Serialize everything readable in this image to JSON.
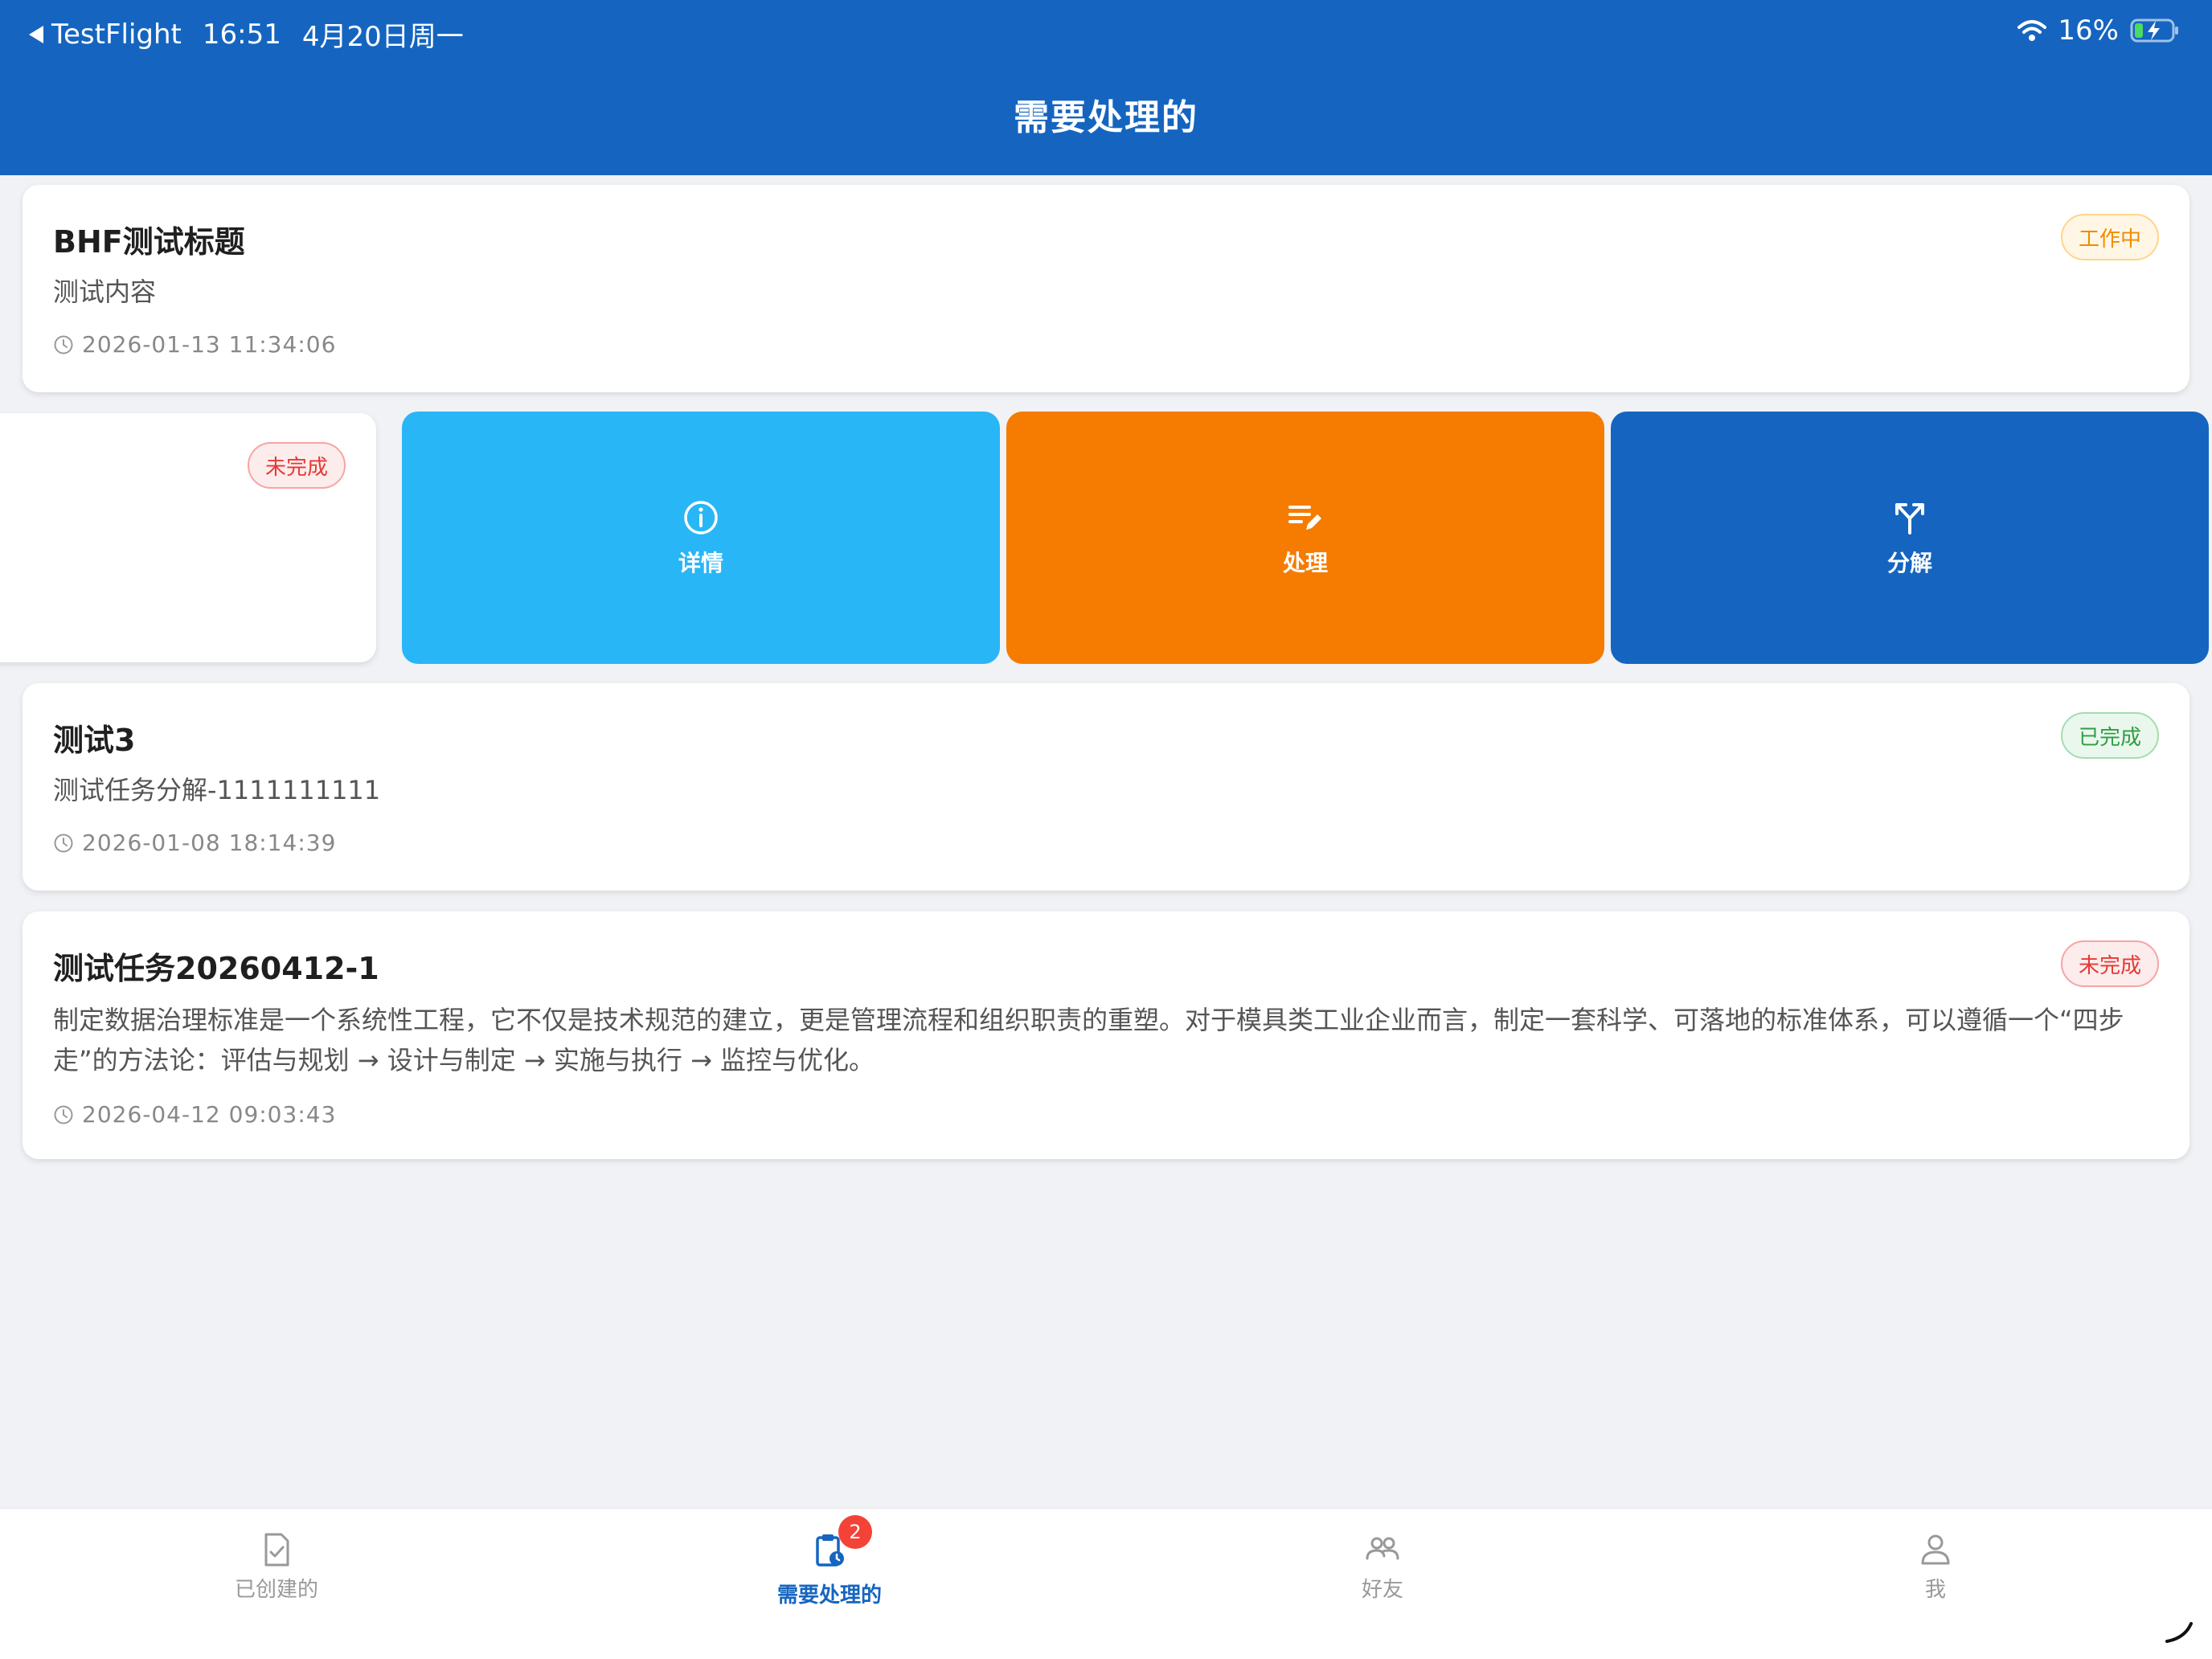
{
  "status_bar": {
    "back_app": "TestFlight",
    "time": "16:51",
    "date": "4月20日周一",
    "battery": "16%"
  },
  "header": {
    "title": "需要处理的"
  },
  "tasks": [
    {
      "title": "BHF测试标题",
      "content": "测试内容",
      "time": "2026-01-13 11:34:06",
      "status": "工作中"
    },
    {
      "status": "未完成",
      "swipe_actions": [
        {
          "label": "详情",
          "icon": "info-icon",
          "color": "#29b6f6"
        },
        {
          "label": "处理",
          "icon": "edit-list-icon",
          "color": "#f57c00"
        },
        {
          "label": "分解",
          "icon": "split-icon",
          "color": "#1565c0"
        }
      ]
    },
    {
      "title": "测试3",
      "content": "测试任务分解-1111111111",
      "time": "2026-01-08 18:14:39",
      "status": "已完成"
    },
    {
      "title": "测试任务20260412-1",
      "content": "制定数据治理标准是一个系统性工程，它不仅是技术规范的建立，更是管理流程和组织职责的重塑。对于模具类工业企业而言，制定一套科学、可落地的标准体系，可以遵循一个“四步走”的方法论：评估与规划 → 设计与制定 → 实施与执行 → 监控与优化。",
      "time": "2026-04-12 09:03:43",
      "status": "未完成"
    }
  ],
  "tabbar": {
    "items": [
      {
        "label": "已创建的",
        "icon": "document-check-icon"
      },
      {
        "label": "需要处理的",
        "icon": "clipboard-clock-icon",
        "badge": "2"
      },
      {
        "label": "好友",
        "icon": "people-icon"
      },
      {
        "label": "我",
        "icon": "person-icon"
      }
    ],
    "active_index": 1
  },
  "colors": {
    "primary": "#1565c0",
    "info": "#29b6f6",
    "handle": "#f57c00",
    "working": "#f08c00",
    "undone": "#e53935",
    "done": "#2e9e46"
  }
}
